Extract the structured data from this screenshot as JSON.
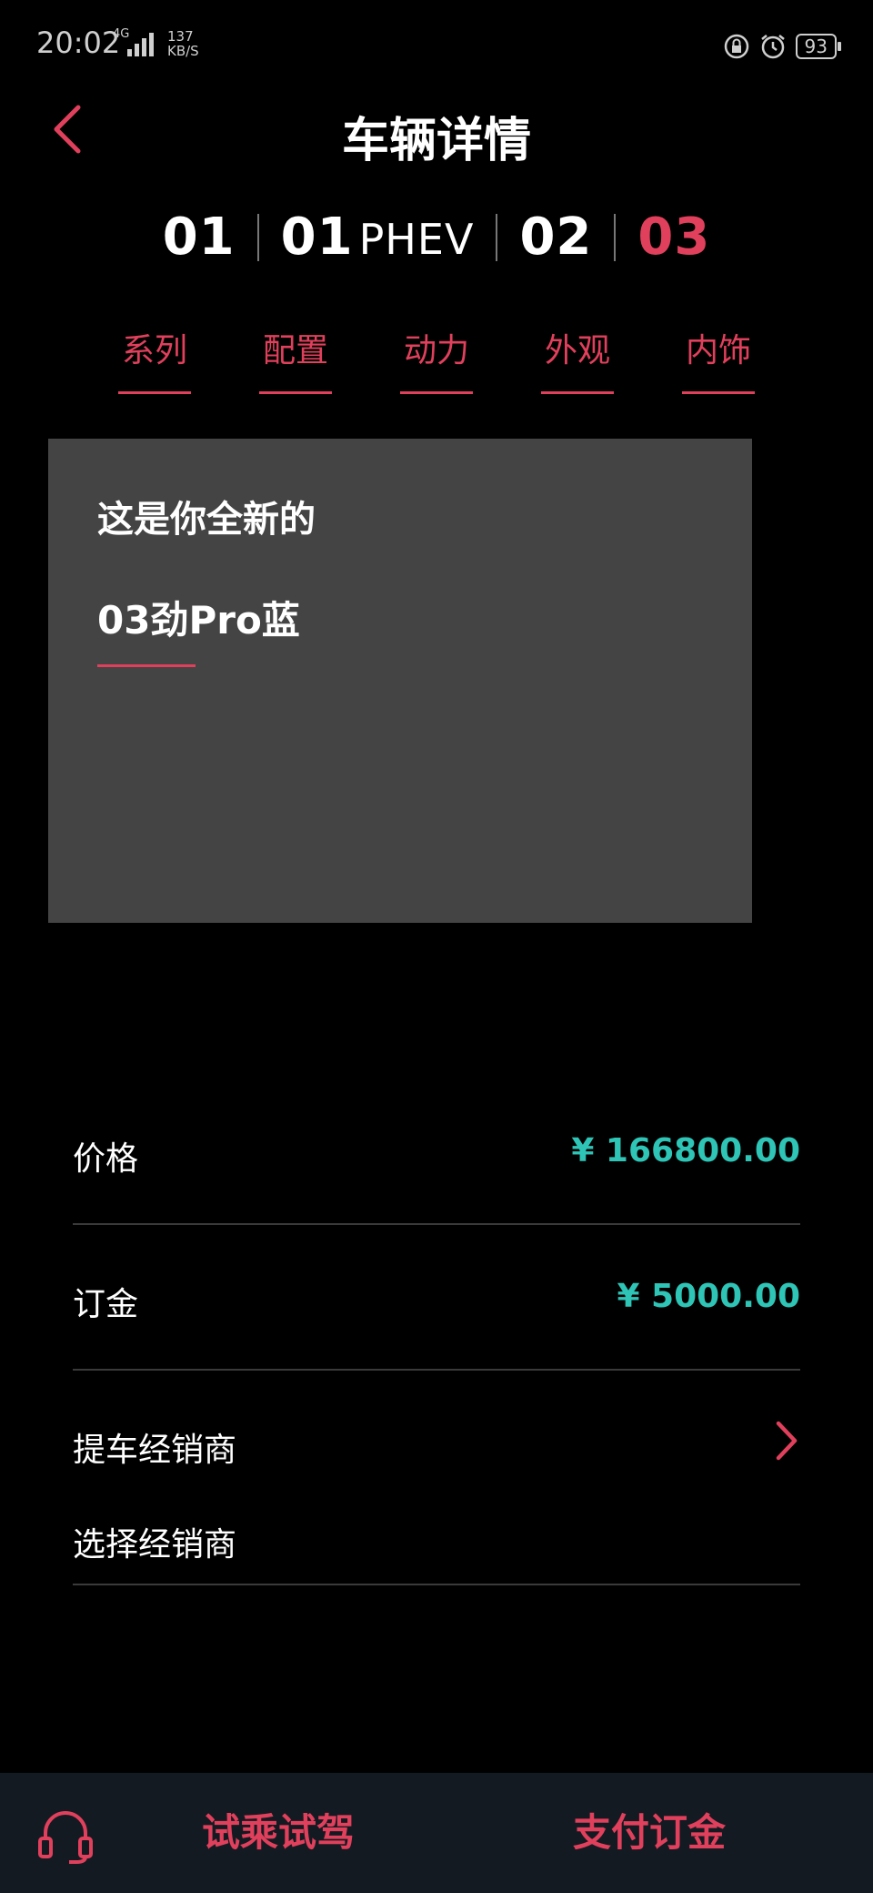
{
  "status_bar": {
    "time": "20:02",
    "network": "4G",
    "speed_value": "137",
    "speed_unit": "KB/S",
    "battery": "93"
  },
  "header": {
    "title": "车辆详情"
  },
  "models": [
    {
      "label": "01",
      "suffix": ""
    },
    {
      "label": "01",
      "suffix": "PHEV"
    },
    {
      "label": "02",
      "suffix": ""
    },
    {
      "label": "03",
      "suffix": ""
    }
  ],
  "active_model_index": 3,
  "tabs": [
    "系列",
    "配置",
    "动力",
    "外观",
    "内饰"
  ],
  "card": {
    "intro": "这是你全新的",
    "model_name": "03劲Pro蓝"
  },
  "price": {
    "label": "价格",
    "value": "¥ 166800.00"
  },
  "deposit": {
    "label": "订金",
    "value": "¥ 5000.00"
  },
  "dealer": {
    "label": "提车经销商",
    "placeholder": "选择经销商"
  },
  "bottom": {
    "test_drive": "试乘试驾",
    "pay_deposit": "支付订金"
  },
  "colors": {
    "accent": "#e0405c",
    "price": "#2ec4b6",
    "card_bg": "#444444",
    "bottom_bar": "#141a22"
  }
}
